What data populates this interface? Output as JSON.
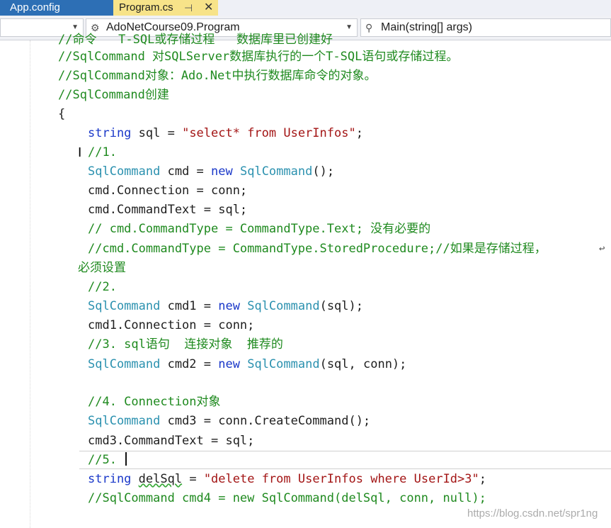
{
  "tabs": {
    "app_config": "App.config",
    "program": "Program.cs",
    "pin_glyph": "⊣",
    "close_glyph": "✕"
  },
  "navbar": {
    "left": "",
    "class_name": "AdoNetCourse09.Program",
    "member_name": "Main(string[] args)"
  },
  "code": {
    "l0": "//命令   T-SQL或存储过程   数据库里已创建好",
    "l1": "//SqlCommand 对SQLServer数据库执行的一个T-SQL语句或存储过程。",
    "l2": "//SqlCommand对象：Ado.Net中执行数据库命令的对象。",
    "l3": "//SqlCommand创建",
    "l4": "{",
    "l5_kw": "string",
    "l5_mid": " sql = ",
    "l5_str": "\"select* from UserInfos\"",
    "l5_end": ";",
    "l6": "//1.",
    "l7_ty": "SqlCommand",
    "l7_a": " cmd = ",
    "l7_kw": "new",
    "l7_sp": " ",
    "l7_ty2": "SqlCommand",
    "l7_end": "();",
    "l8": "cmd.Connection = conn;",
    "l9": "cmd.CommandText = sql;",
    "l10": "// cmd.CommandType = CommandType.Text; 没有必要的",
    "l11": "//cmd.CommandType = CommandType.StoredProcedure;//如果是存储过程，",
    "l12": "必须设置",
    "l13": "//2.",
    "l14_ty": "SqlCommand",
    "l14_a": " cmd1 = ",
    "l14_kw": "new",
    "l14_sp": " ",
    "l14_ty2": "SqlCommand",
    "l14_end": "(sql);",
    "l15": "cmd1.Connection = conn;",
    "l16": "//3. sql语句  连接对象  推荐的",
    "l17_ty": "SqlCommand",
    "l17_a": " cmd2 = ",
    "l17_kw": "new",
    "l17_sp": " ",
    "l17_ty2": "SqlCommand",
    "l17_end": "(sql, conn);",
    "l18": "//4. Connection对象",
    "l19_ty": "SqlCommand",
    "l19_end": " cmd3 = conn.CreateCommand();",
    "l20": "cmd3.CommandText = sql;",
    "l21": "//5. ",
    "l22_kw": "string",
    "l22_sp": " ",
    "l22_var": "delSql",
    "l22_mid": " = ",
    "l22_str": "\"delete from UserInfos where UserId>3\"",
    "l22_end": ";",
    "l23": "//SqlCommand cmd4 = new SqlCommand(delSql, conn, null);"
  },
  "watermark": "https://blog.csdn.net/spr1ng",
  "colors": {
    "comment": "#1f8a1f",
    "keyword": "#1a38c9",
    "type": "#2b91af",
    "string": "#a31515",
    "active_tab": "#f7e389",
    "inactive_tab": "#2d6fb5"
  }
}
